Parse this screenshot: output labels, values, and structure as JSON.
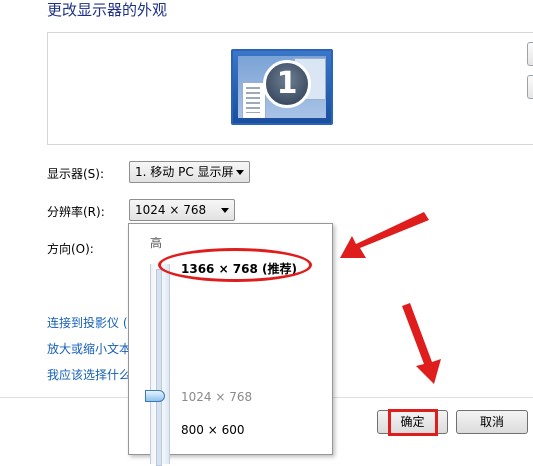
{
  "page": {
    "title": "更改显示器的外观"
  },
  "preview": {
    "monitor_number": "1"
  },
  "settings": {
    "display_label": "显示器(S):",
    "display_value": "1. 移动 PC 显示屏",
    "resolution_label": "分辨率(R):",
    "resolution_value": "1024 × 768",
    "orientation_label": "方向(O):"
  },
  "resolution_dropdown": {
    "high_label": "高",
    "options": [
      {
        "label": "1366 × 768 (推荐)",
        "bold": true
      },
      {
        "label": "1024 × 768",
        "current": true
      },
      {
        "label": "800 × 600"
      }
    ],
    "slider_level": 0.62
  },
  "links": [
    "连接到投影仪 (",
    "放大或缩小文本",
    "我应该选择什么"
  ],
  "footer": {
    "ok_label": "确定",
    "cancel_label": "取消"
  },
  "colors": {
    "title": "#1e3287",
    "link": "#1560b8",
    "annotation": "#e01d1d"
  }
}
